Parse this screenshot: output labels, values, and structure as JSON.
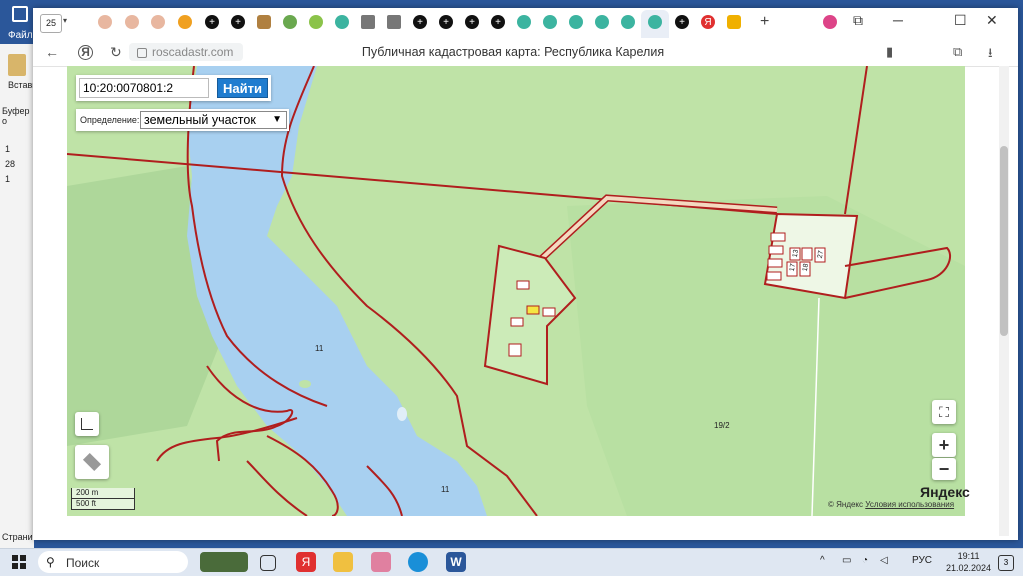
{
  "word": {
    "file_tab": "Файл",
    "paste_label": "Вставить",
    "clipboard_label": "Буфер о",
    "ruler_marks": [
      "1",
      "28",
      "1"
    ],
    "status_left": "Страни"
  },
  "browser": {
    "tab_count": "25",
    "url": "roscadastr.com",
    "page_title": "Публичная кадастровая карта: Республика Карелия"
  },
  "map": {
    "search_value": "10:20:0070801:2",
    "search_button": "Найти",
    "definition_label": "Определение:",
    "definition_value": "земельный участок",
    "labels": {
      "parcel_11_a": "11",
      "parcel_11_b": "11",
      "parcel_19_2": "19/2",
      "plot_17": "17",
      "plot_13": "13",
      "plot_18": "18",
      "plot_27": "27"
    },
    "scale_m": "200 m",
    "scale_ft": "500 ft",
    "copyright": "© Яндекс",
    "terms": "Условия использования",
    "logo": "Яндекс",
    "zoom_in": "+",
    "zoom_out": "−"
  },
  "taskbar": {
    "search_placeholder": "Поиск",
    "lang": "РУС",
    "time": "19:11",
    "date": "21.02.2024",
    "notifications": "3"
  },
  "colors": {
    "water": "#a8d0f0",
    "land": "#bfe3a7",
    "boundary": "#b01e1e",
    "accent": "#1f7ccf",
    "word_blue": "#2b579a"
  }
}
